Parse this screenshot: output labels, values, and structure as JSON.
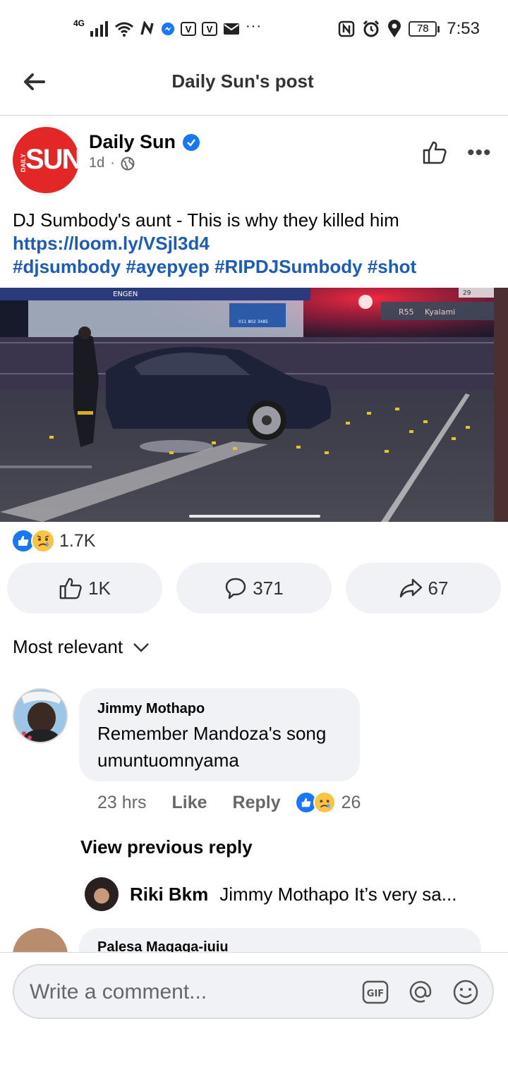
{
  "status_bar": {
    "network": "4G",
    "battery": "78",
    "time": "7:53"
  },
  "header": {
    "title": "Daily Sun's post"
  },
  "post": {
    "page_name": "Daily Sun",
    "avatar_text": "SUN",
    "avatar_small_text": "DAILY",
    "time_ago": "1d",
    "separator": "·",
    "text": "DJ Sumbody's aunt - This is why they killed him",
    "link": "https://loom.ly/VSjl3d4",
    "hashtags": "#djsumbody #ayepyep #RIPDJSumbody #shot",
    "photo_signs": {
      "station": "ENGEN",
      "phone": "011 802 3485",
      "route": "R55",
      "place": "Kyalami",
      "route_num": "29"
    },
    "reaction_count": "1.7K",
    "like_count": "1K",
    "comment_count": "371",
    "share_count": "67"
  },
  "sort": {
    "label": "Most relevant"
  },
  "comments": [
    {
      "author": "Jimmy Mothapo",
      "text": "Remember Mandoza's song umuntuomnyama",
      "time": "23 hrs",
      "like_label": "Like",
      "reply_label": "Reply",
      "reaction_count": "26"
    }
  ],
  "replies": {
    "view_previous": "View previous reply",
    "latest": {
      "author": "Riki Bkm",
      "text": "Jimmy Mothapo It’s very sa..."
    }
  },
  "next_comment": {
    "author": "Palesa Magaga-iuiu"
  },
  "composer": {
    "placeholder": "Write a comment...",
    "gif_label": "GIF"
  },
  "colors": {
    "accent": "#1877f2",
    "link": "#1a5cb8",
    "sun_red": "#e32726"
  }
}
